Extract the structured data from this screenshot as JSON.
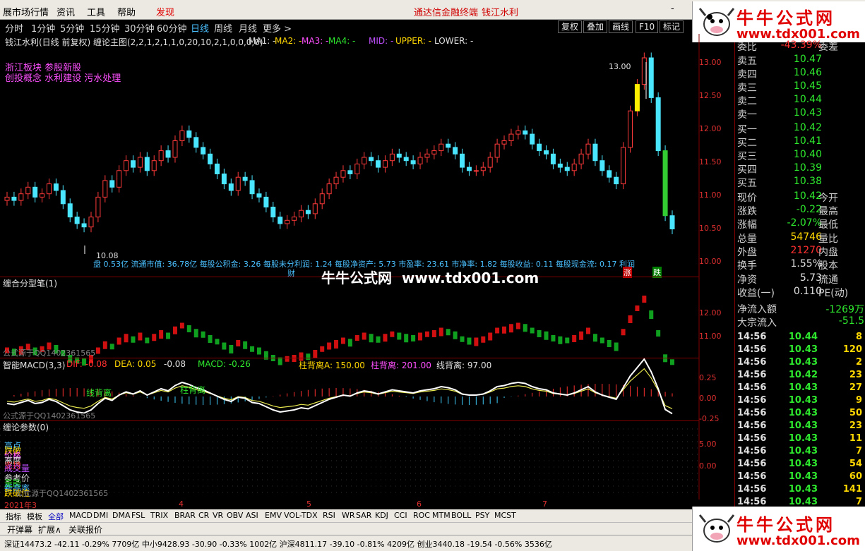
{
  "menu": {
    "items": [
      "展市场行情",
      "资讯",
      "工具",
      "帮助"
    ],
    "alert": "发现",
    "center": "通达信金融终端",
    "stock": "钱江水利",
    "window_controls": [
      "-",
      "×"
    ]
  },
  "brand": {
    "text": "牛牛公式网",
    "url": "www.tdx001.com"
  },
  "timeframes": [
    "分时",
    "1分钟",
    "5分钟",
    "15分钟",
    "30分钟",
    "60分钟",
    "日线",
    "周线",
    "月线",
    "更多 >"
  ],
  "active_timeframe": "日线",
  "toolbar_buttons": [
    "复权",
    "叠加",
    "画线",
    "F10",
    "标记"
  ],
  "main_title": "钱江水利(日线 前复权) 缠论主图(2,2,1,2,1,1,0,20,10,2,1,0,0,0,0)",
  "ma_labels": [
    "MA1: -",
    "MA2: -",
    "MA3: -",
    "MA4: -",
    "MID: -",
    "UPPER: -",
    "LOWER: -"
  ],
  "concepts": [
    "浙江板块 参股新股",
    "创投概念 水利建设 污水处理"
  ],
  "annotations": {
    "high": "13.00",
    "low": "10.08"
  },
  "fundamentals": "盘 0.53亿  流通市值: 36.78亿  每股公积金: 3.26  每股未分利润: 1.24  每股净资产: 5.73  市盈率: 23.61  市净率: 1.82  每股收益: 0.11  每股现金流: 0.17  利润",
  "markers": {
    "cai": "财",
    "zhang": "涨",
    "die": "跌"
  },
  "main_yaxis": [
    "13.00",
    "12.50",
    "12.00",
    "11.50",
    "11.00",
    "10.50",
    "10.00"
  ],
  "panel2": {
    "title": "缠合分型笔(1)",
    "foot": "公式源于QQ1402361565",
    "yaxis": [
      "12.00",
      "11.00"
    ]
  },
  "panel3": {
    "name": "智能MACD(3,3)",
    "dif": "DIF: -0.08",
    "dea": "DEA: 0.05",
    "third": "-0.08",
    "macd": "MACD: -0.26",
    "a": "柱背离A: 150.00",
    "b": "柱背离: 201.00",
    "c": "线背离: 97.00",
    "foot": "公式源于QQ1402361565",
    "tag1": "线背离",
    "tag2": "柱背离",
    "yaxis": [
      "0.25",
      "0.00",
      "-0.25"
    ]
  },
  "panel4": {
    "title": "缠论参数(0)",
    "labels": [
      "高点",
      "跌破",
      "价格",
      "离度",
      "支持",
      "成交量",
      "参考价",
      "量能",
      "新高率",
      "跌破位"
    ],
    "foot": "公式源于QQ1402361565",
    "yaxis": [
      "5.00",
      "0.00"
    ]
  },
  "dates": [
    "2021年3",
    "4",
    "5",
    "6",
    "7"
  ],
  "tabs": [
    "指标",
    "模板",
    "全部",
    "MACD",
    "DMI",
    "DMA",
    "FSL",
    "TRIX",
    "BRAR",
    "CR",
    "VR",
    "OBV",
    "ASI",
    "EMV",
    "VOL-TDX",
    "RSI",
    "WR",
    "SAR",
    "KDJ",
    "CCI",
    "ROC",
    "MTM",
    "BOLL",
    "PSY",
    "MCST"
  ],
  "tabs2": [
    "开弹幕",
    "扩展∧",
    "关联报价"
  ],
  "status_bar": "深证14473.2  -42.11  -0.29%  7709亿  中小9428.93  -30.90  -0.33%  1002亿  沪深4811.17  -39.10  -0.81%  4209亿  创业3440.18  -19.54  -0.56%  3536亿",
  "right_panel": {
    "top": {
      "label": "委比",
      "value": "-43.39%",
      "label2": "委差"
    },
    "sells": [
      {
        "label": "卖五",
        "price": "10.47"
      },
      {
        "label": "卖四",
        "price": "10.46"
      },
      {
        "label": "卖三",
        "price": "10.45"
      },
      {
        "label": "卖二",
        "price": "10.44"
      },
      {
        "label": "卖一",
        "price": "10.43"
      }
    ],
    "buys": [
      {
        "label": "买一",
        "price": "10.42"
      },
      {
        "label": "买二",
        "price": "10.41"
      },
      {
        "label": "买三",
        "price": "10.40"
      },
      {
        "label": "买四",
        "price": "10.39"
      },
      {
        "label": "买五",
        "price": "10.38"
      }
    ],
    "quotes": [
      {
        "label": "现价",
        "value": "10.42",
        "label2": "今开",
        "color": "#2ee82e"
      },
      {
        "label": "涨跌",
        "value": "-0.22",
        "label2": "最高",
        "color": "#2ee82e"
      },
      {
        "label": "涨幅",
        "value": "-2.07%",
        "label2": "最低",
        "color": "#2ee82e"
      },
      {
        "label": "总量",
        "value": "54746",
        "label2": "量比",
        "color": "#ffd700"
      },
      {
        "label": "外盘",
        "value": "21270",
        "label2": "内盘",
        "color": "#ff3030"
      },
      {
        "label": "换手",
        "value": "1.55%",
        "label2": "股本",
        "color": "#e0e0e0"
      },
      {
        "label": "净资",
        "value": "5.73",
        "label2": "流通",
        "color": "#e0e0e0"
      },
      {
        "label": "收益(一)",
        "value": "0.110",
        "label2": "PE(动)",
        "color": "#e0e0e0"
      },
      {
        "label": "净流入额",
        "value": "-1269万",
        "label2": "",
        "color": "#2ee82e"
      },
      {
        "label": "大宗流入",
        "value": "-51.5",
        "label2": "",
        "color": "#2ee82e"
      }
    ],
    "ticks": [
      {
        "time": "14:56",
        "price": "10.44",
        "vol": "8",
        "vcolor": "#ffd700"
      },
      {
        "time": "14:56",
        "price": "10.43",
        "vol": "120",
        "vcolor": "#ffd700"
      },
      {
        "time": "14:56",
        "price": "10.43",
        "vol": "2",
        "vcolor": "#ffd700"
      },
      {
        "time": "14:56",
        "price": "10.42",
        "vol": "23",
        "vcolor": "#ffd700"
      },
      {
        "time": "14:56",
        "price": "10.43",
        "vol": "27",
        "vcolor": "#ffd700"
      },
      {
        "time": "14:56",
        "price": "10.43",
        "vol": "9",
        "vcolor": "#ffd700"
      },
      {
        "time": "14:56",
        "price": "10.43",
        "vol": "50",
        "vcolor": "#ffd700"
      },
      {
        "time": "14:56",
        "price": "10.43",
        "vol": "23",
        "vcolor": "#ffd700"
      },
      {
        "time": "14:56",
        "price": "10.43",
        "vol": "11",
        "vcolor": "#ffd700"
      },
      {
        "time": "14:56",
        "price": "10.43",
        "vol": "7",
        "vcolor": "#ffd700"
      },
      {
        "time": "14:56",
        "price": "10.43",
        "vol": "54",
        "vcolor": "#ffd700"
      },
      {
        "time": "14:56",
        "price": "10.43",
        "vol": "60",
        "vcolor": "#ffd700"
      },
      {
        "time": "14:56",
        "price": "10.43",
        "vol": "141",
        "vcolor": "#ffd700"
      },
      {
        "time": "14:56",
        "price": "10.43",
        "vol": "7",
        "vcolor": "#ffd700"
      }
    ]
  },
  "chart_data": {
    "type": "candlestick",
    "ylim": [
      10.0,
      13.0
    ],
    "closes": [
      10.9,
      10.85,
      10.95,
      11.05,
      10.9,
      10.95,
      11.1,
      11.0,
      10.8,
      10.6,
      10.5,
      10.45,
      10.6,
      10.9,
      11.15,
      11.05,
      11.3,
      11.45,
      11.35,
      11.5,
      11.3,
      11.45,
      11.6,
      11.5,
      11.75,
      11.9,
      11.8,
      11.65,
      11.55,
      11.4,
      11.25,
      11.1,
      11.0,
      11.2,
      11.15,
      10.95,
      10.9,
      10.75,
      10.6,
      10.5,
      10.55,
      10.6,
      10.7,
      10.65,
      10.8,
      10.95,
      11.1,
      11.2,
      11.3,
      11.25,
      11.4,
      11.5,
      11.45,
      11.35,
      11.45,
      11.55,
      11.5,
      11.45,
      11.4,
      11.5,
      11.55,
      11.6,
      11.7,
      11.65,
      11.55,
      11.35,
      11.3,
      11.3,
      11.35,
      11.5,
      11.7,
      11.75,
      11.85,
      11.9,
      11.85,
      11.7,
      11.6,
      11.55,
      11.4,
      11.35,
      11.3,
      11.4,
      11.55,
      11.7,
      11.45,
      11.3,
      11.2,
      11.1,
      11.65,
      12.2,
      12.6,
      13.0,
      12.4,
      11.6,
      10.62,
      10.42
    ]
  }
}
